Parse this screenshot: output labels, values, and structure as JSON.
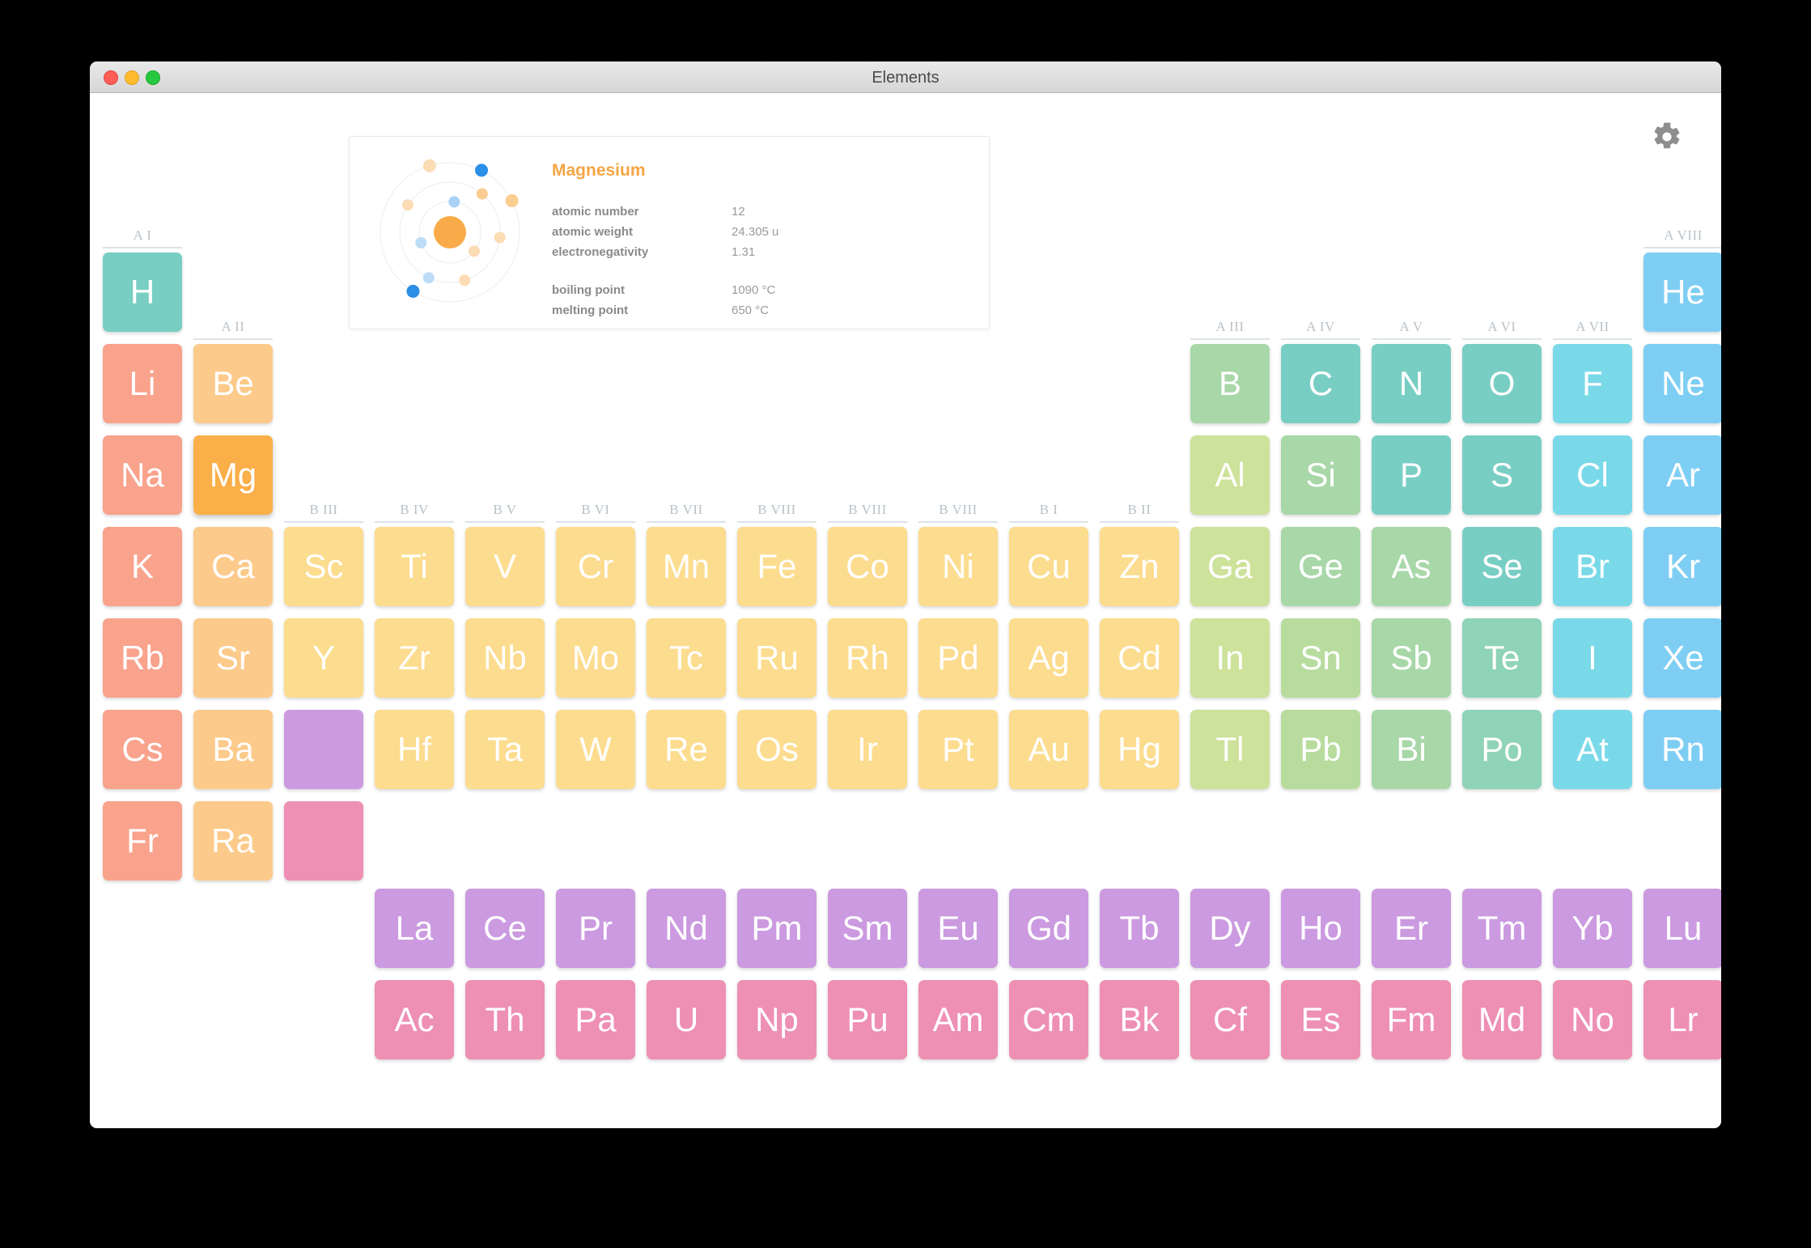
{
  "window": {
    "title": "Elements",
    "traffic_lights": [
      "close-button",
      "minimize-button",
      "zoom-button"
    ],
    "gear_icon": "gear-icon"
  },
  "detail_card": {
    "element_name": "Magnesium",
    "accent_color": "#f5a544",
    "properties": [
      {
        "label": "atomic number",
        "value": "12"
      },
      {
        "label": "atomic weight",
        "value": "24.305 u"
      },
      {
        "label": "electronegativity",
        "value": "1.31"
      }
    ],
    "properties2": [
      {
        "label": "boiling point",
        "value": "1090 °C"
      },
      {
        "label": "melting point",
        "value": "650 °C"
      }
    ],
    "atom_diagram": {
      "nucleus_color": "#f9ab49",
      "shells": 3,
      "electrons": [
        {
          "shell": 1,
          "angle": 8,
          "color": "#a9d2f5",
          "r": 7
        },
        {
          "shell": 1,
          "angle": 128,
          "color": "#fbdcb4",
          "r": 7
        },
        {
          "shell": 1,
          "angle": 250,
          "color": "#bcdcf7",
          "r": 7
        },
        {
          "shell": 2,
          "angle": 40,
          "color": "#fbcd91",
          "r": 7
        },
        {
          "shell": 2,
          "angle": 96,
          "color": "#fbdcb4",
          "r": 7
        },
        {
          "shell": 2,
          "angle": 163,
          "color": "#fbdcb4",
          "r": 7
        },
        {
          "shell": 2,
          "angle": 205,
          "color": "#bcdcf7",
          "r": 7
        },
        {
          "shell": 2,
          "angle": 303,
          "color": "#fbdcb4",
          "r": 7
        },
        {
          "shell": 3,
          "angle": 27,
          "color": "#2b8fe8",
          "r": 8
        },
        {
          "shell": 3,
          "angle": 63,
          "color": "#fbcd91",
          "r": 8
        },
        {
          "shell": 3,
          "angle": 343,
          "color": "#fbdcb4",
          "r": 8
        },
        {
          "shell": 3,
          "angle": 212,
          "color": "#2b8fe8",
          "r": 8
        }
      ]
    }
  },
  "group_headers": [
    {
      "label": "A I",
      "col": 1,
      "row": 1
    },
    {
      "label": "A II",
      "col": 2,
      "row": 2
    },
    {
      "label": "B III",
      "col": 3,
      "row": 4
    },
    {
      "label": "B IV",
      "col": 4,
      "row": 4
    },
    {
      "label": "B V",
      "col": 5,
      "row": 4
    },
    {
      "label": "B VI",
      "col": 6,
      "row": 4
    },
    {
      "label": "B VII",
      "col": 7,
      "row": 4
    },
    {
      "label": "B VIII",
      "col": 8,
      "row": 4
    },
    {
      "label": "B VIII",
      "col": 9,
      "row": 4
    },
    {
      "label": "B VIII",
      "col": 10,
      "row": 4
    },
    {
      "label": "B I",
      "col": 11,
      "row": 4
    },
    {
      "label": "B II",
      "col": 12,
      "row": 4
    },
    {
      "label": "A III",
      "col": 13,
      "row": 2
    },
    {
      "label": "A IV",
      "col": 14,
      "row": 2
    },
    {
      "label": "A V",
      "col": 15,
      "row": 2
    },
    {
      "label": "A VI",
      "col": 16,
      "row": 2
    },
    {
      "label": "A VII",
      "col": 17,
      "row": 2
    },
    {
      "label": "A VIII",
      "col": 18,
      "row": 1
    }
  ],
  "elements": [
    {
      "symbol": "H",
      "col": 1,
      "row": 1,
      "color": "#79cec4"
    },
    {
      "symbol": "He",
      "col": 18,
      "row": 1,
      "color": "#7ecef4"
    },
    {
      "symbol": "Li",
      "col": 1,
      "row": 2,
      "color": "#f9a28c"
    },
    {
      "symbol": "Be",
      "col": 2,
      "row": 2,
      "color": "#fcca8a"
    },
    {
      "symbol": "B",
      "col": 13,
      "row": 2,
      "color": "#a8d7a8"
    },
    {
      "symbol": "C",
      "col": 14,
      "row": 2,
      "color": "#79cec4"
    },
    {
      "symbol": "N",
      "col": 15,
      "row": 2,
      "color": "#79cec4"
    },
    {
      "symbol": "O",
      "col": 16,
      "row": 2,
      "color": "#79cec4"
    },
    {
      "symbol": "F",
      "col": 17,
      "row": 2,
      "color": "#7ad9e8"
    },
    {
      "symbol": "Ne",
      "col": 18,
      "row": 2,
      "color": "#7ecef4"
    },
    {
      "symbol": "Na",
      "col": 1,
      "row": 3,
      "color": "#f9a28c"
    },
    {
      "symbol": "Mg",
      "col": 2,
      "row": 3,
      "color": "#fbaf49",
      "selected": true
    },
    {
      "symbol": "Al",
      "col": 13,
      "row": 3,
      "color": "#cde29a"
    },
    {
      "symbol": "Si",
      "col": 14,
      "row": 3,
      "color": "#a8d7a8"
    },
    {
      "symbol": "P",
      "col": 15,
      "row": 3,
      "color": "#79cec4"
    },
    {
      "symbol": "S",
      "col": 16,
      "row": 3,
      "color": "#79cec4"
    },
    {
      "symbol": "Cl",
      "col": 17,
      "row": 3,
      "color": "#7ad9e8"
    },
    {
      "symbol": "Ar",
      "col": 18,
      "row": 3,
      "color": "#7ecef4"
    },
    {
      "symbol": "K",
      "col": 1,
      "row": 4,
      "color": "#f9a28c"
    },
    {
      "symbol": "Ca",
      "col": 2,
      "row": 4,
      "color": "#fcca8a"
    },
    {
      "symbol": "Sc",
      "col": 3,
      "row": 4,
      "color": "#fcdc8e"
    },
    {
      "symbol": "Ti",
      "col": 4,
      "row": 4,
      "color": "#fcdc8e"
    },
    {
      "symbol": "V",
      "col": 5,
      "row": 4,
      "color": "#fcdc8e"
    },
    {
      "symbol": "Cr",
      "col": 6,
      "row": 4,
      "color": "#fcdc8e"
    },
    {
      "symbol": "Mn",
      "col": 7,
      "row": 4,
      "color": "#fcdc8e"
    },
    {
      "symbol": "Fe",
      "col": 8,
      "row": 4,
      "color": "#fcdc8e"
    },
    {
      "symbol": "Co",
      "col": 9,
      "row": 4,
      "color": "#fcdc8e"
    },
    {
      "symbol": "Ni",
      "col": 10,
      "row": 4,
      "color": "#fcdc8e"
    },
    {
      "symbol": "Cu",
      "col": 11,
      "row": 4,
      "color": "#fcdc8e"
    },
    {
      "symbol": "Zn",
      "col": 12,
      "row": 4,
      "color": "#fcdc8e"
    },
    {
      "symbol": "Ga",
      "col": 13,
      "row": 4,
      "color": "#cde29a"
    },
    {
      "symbol": "Ge",
      "col": 14,
      "row": 4,
      "color": "#a8d7a8"
    },
    {
      "symbol": "As",
      "col": 15,
      "row": 4,
      "color": "#a8d7a8"
    },
    {
      "symbol": "Se",
      "col": 16,
      "row": 4,
      "color": "#79cec4"
    },
    {
      "symbol": "Br",
      "col": 17,
      "row": 4,
      "color": "#7ad9e8"
    },
    {
      "symbol": "Kr",
      "col": 18,
      "row": 4,
      "color": "#7ecef4"
    },
    {
      "symbol": "Rb",
      "col": 1,
      "row": 5,
      "color": "#f9a28c"
    },
    {
      "symbol": "Sr",
      "col": 2,
      "row": 5,
      "color": "#fcca8a"
    },
    {
      "symbol": "Y",
      "col": 3,
      "row": 5,
      "color": "#fcdc8e"
    },
    {
      "symbol": "Zr",
      "col": 4,
      "row": 5,
      "color": "#fcdc8e"
    },
    {
      "symbol": "Nb",
      "col": 5,
      "row": 5,
      "color": "#fcdc8e"
    },
    {
      "symbol": "Mo",
      "col": 6,
      "row": 5,
      "color": "#fcdc8e"
    },
    {
      "symbol": "Tc",
      "col": 7,
      "row": 5,
      "color": "#fcdc8e"
    },
    {
      "symbol": "Ru",
      "col": 8,
      "row": 5,
      "color": "#fcdc8e"
    },
    {
      "symbol": "Rh",
      "col": 9,
      "row": 5,
      "color": "#fcdc8e"
    },
    {
      "symbol": "Pd",
      "col": 10,
      "row": 5,
      "color": "#fcdc8e"
    },
    {
      "symbol": "Ag",
      "col": 11,
      "row": 5,
      "color": "#fcdc8e"
    },
    {
      "symbol": "Cd",
      "col": 12,
      "row": 5,
      "color": "#fcdc8e"
    },
    {
      "symbol": "In",
      "col": 13,
      "row": 5,
      "color": "#cde29a"
    },
    {
      "symbol": "Sn",
      "col": 14,
      "row": 5,
      "color": "#b8dc9e"
    },
    {
      "symbol": "Sb",
      "col": 15,
      "row": 5,
      "color": "#a8d7a8"
    },
    {
      "symbol": "Te",
      "col": 16,
      "row": 5,
      "color": "#8fd3b8"
    },
    {
      "symbol": "I",
      "col": 17,
      "row": 5,
      "color": "#7ad9e8"
    },
    {
      "symbol": "Xe",
      "col": 18,
      "row": 5,
      "color": "#7ecef4"
    },
    {
      "symbol": "Cs",
      "col": 1,
      "row": 6,
      "color": "#f9a28c"
    },
    {
      "symbol": "Ba",
      "col": 2,
      "row": 6,
      "color": "#fcca8a"
    },
    {
      "symbol": "",
      "col": 3,
      "row": 6,
      "color": "#cb9ae0",
      "blank": true,
      "name": "lanthanide-series-tile"
    },
    {
      "symbol": "Hf",
      "col": 4,
      "row": 6,
      "color": "#fcdc8e"
    },
    {
      "symbol": "Ta",
      "col": 5,
      "row": 6,
      "color": "#fcdc8e"
    },
    {
      "symbol": "W",
      "col": 6,
      "row": 6,
      "color": "#fcdc8e"
    },
    {
      "symbol": "Re",
      "col": 7,
      "row": 6,
      "color": "#fcdc8e"
    },
    {
      "symbol": "Os",
      "col": 8,
      "row": 6,
      "color": "#fcdc8e"
    },
    {
      "symbol": "Ir",
      "col": 9,
      "row": 6,
      "color": "#fcdc8e"
    },
    {
      "symbol": "Pt",
      "col": 10,
      "row": 6,
      "color": "#fcdc8e"
    },
    {
      "symbol": "Au",
      "col": 11,
      "row": 6,
      "color": "#fcdc8e"
    },
    {
      "symbol": "Hg",
      "col": 12,
      "row": 6,
      "color": "#fcdc8e"
    },
    {
      "symbol": "Tl",
      "col": 13,
      "row": 6,
      "color": "#cde29a"
    },
    {
      "symbol": "Pb",
      "col": 14,
      "row": 6,
      "color": "#b8dc9e"
    },
    {
      "symbol": "Bi",
      "col": 15,
      "row": 6,
      "color": "#a8d7a8"
    },
    {
      "symbol": "Po",
      "col": 16,
      "row": 6,
      "color": "#8fd3b8"
    },
    {
      "symbol": "At",
      "col": 17,
      "row": 6,
      "color": "#7ad9e8"
    },
    {
      "symbol": "Rn",
      "col": 18,
      "row": 6,
      "color": "#7ecef4"
    },
    {
      "symbol": "Fr",
      "col": 1,
      "row": 7,
      "color": "#f9a28c"
    },
    {
      "symbol": "Ra",
      "col": 2,
      "row": 7,
      "color": "#fcca8a"
    },
    {
      "symbol": "",
      "col": 3,
      "row": 7,
      "color": "#ee8fb4",
      "blank": true,
      "name": "actinide-series-tile"
    }
  ],
  "lanthanides": {
    "color": "#cb9ae0",
    "symbols": [
      "La",
      "Ce",
      "Pr",
      "Nd",
      "Pm",
      "Sm",
      "Eu",
      "Gd",
      "Tb",
      "Dy",
      "Ho",
      "Er",
      "Tm",
      "Yb",
      "Lu"
    ]
  },
  "actinides": {
    "color": "#ee8fb4",
    "symbols": [
      "Ac",
      "Th",
      "Pa",
      "U",
      "Np",
      "Pu",
      "Am",
      "Cm",
      "Bk",
      "Cf",
      "Es",
      "Fm",
      "Md",
      "No",
      "Lr"
    ]
  }
}
